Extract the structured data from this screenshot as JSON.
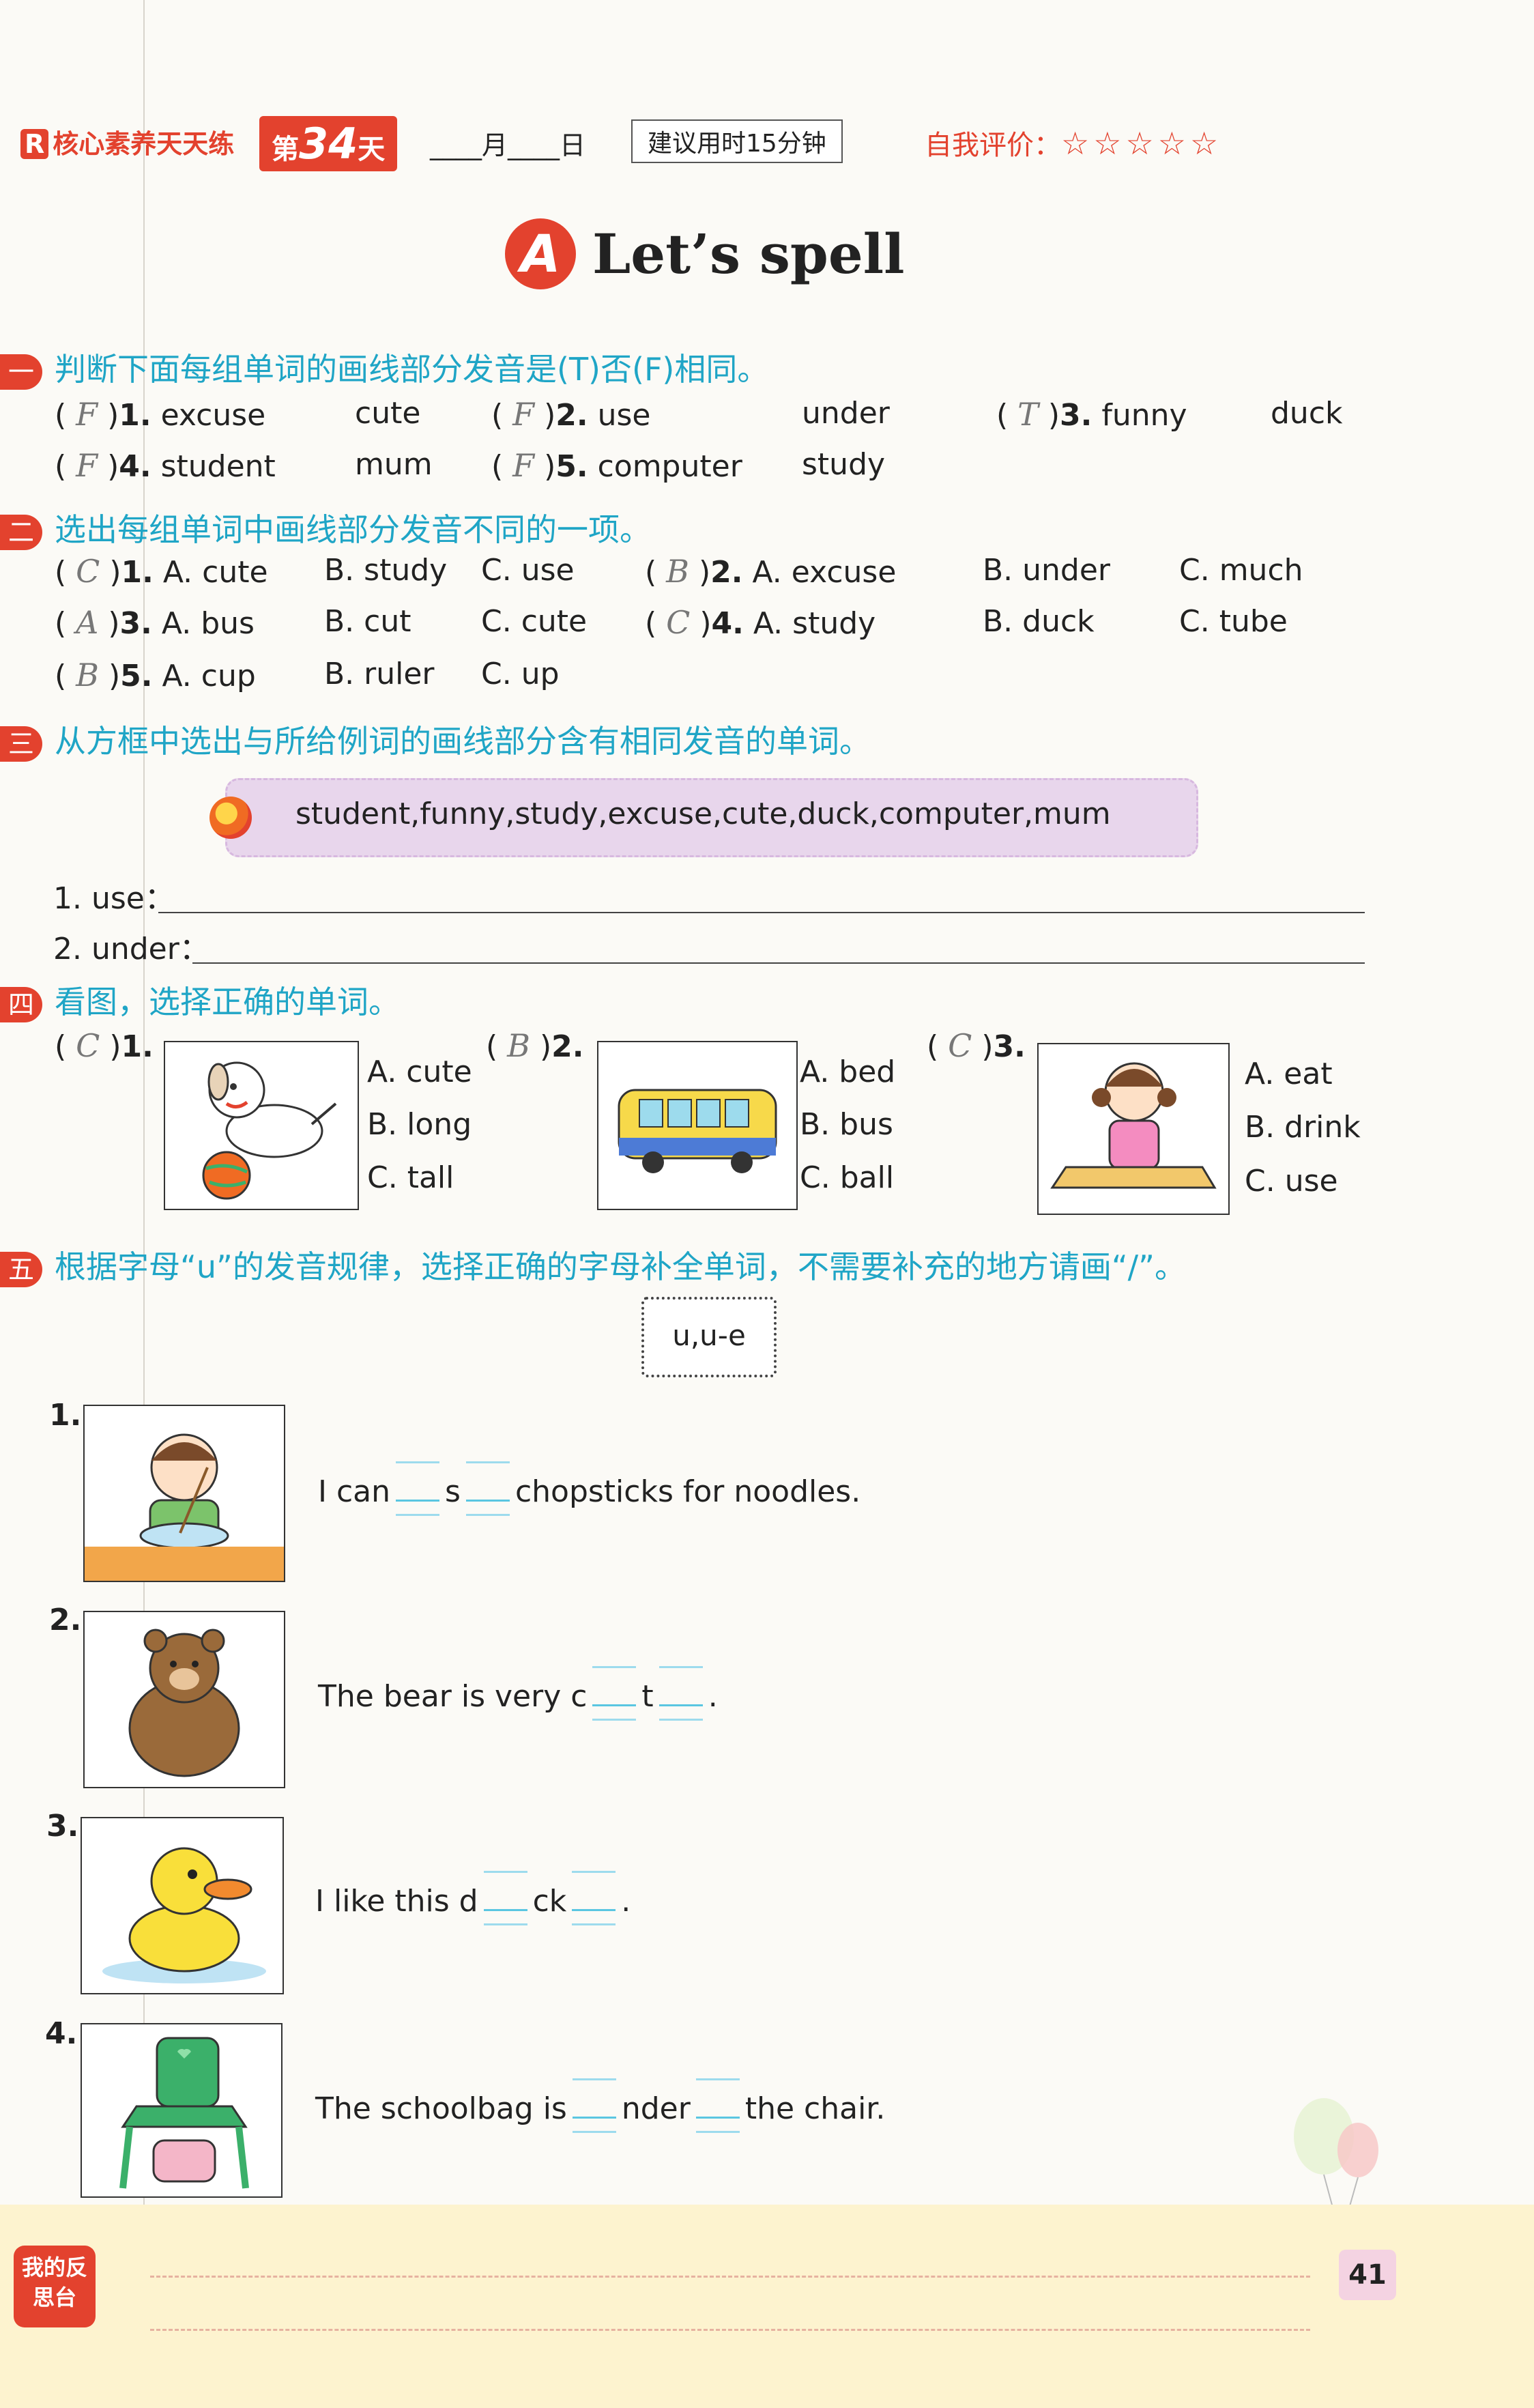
{
  "header": {
    "brand": "核心素养天天练",
    "brand_badge": "R",
    "day_prefix": "第",
    "day_num": "34",
    "day_suffix": "天",
    "date": "____月____日",
    "suggest": "建议用时15分钟",
    "rating_label": "自我评价：",
    "stars": "☆☆☆☆☆"
  },
  "section_a": {
    "badge": "A",
    "title": "Let’s spell"
  },
  "part1": {
    "num": "一",
    "title": "判断下面每组单词的画线部分发音是(T)否(F)相同。",
    "items": [
      {
        "num": "1.",
        "answer": "F",
        "w1": "excuse",
        "w2": "cute"
      },
      {
        "num": "2.",
        "answer": "F",
        "w1": "use",
        "w2": "under"
      },
      {
        "num": "3.",
        "answer": "T",
        "w1": "funny",
        "w2": "duck"
      },
      {
        "num": "4.",
        "answer": "F",
        "w1": "student",
        "w2": "mum"
      },
      {
        "num": "5.",
        "answer": "F",
        "w1": "computer",
        "w2": "study"
      }
    ]
  },
  "part2": {
    "num": "二",
    "title": "选出每组单词中画线部分发音不同的一项。",
    "items": [
      {
        "num": "1.",
        "answer": "C",
        "a": "A. cute",
        "b": "B. study",
        "c": "C. use"
      },
      {
        "num": "2.",
        "answer": "B",
        "a": "A. excuse",
        "b": "B. under",
        "c": "C. much"
      },
      {
        "num": "3.",
        "answer": "A",
        "a": "A. bus",
        "b": "B. cut",
        "c": "C. cute"
      },
      {
        "num": "4.",
        "answer": "C",
        "a": "A. study",
        "b": "B. duck",
        "c": "C. tube"
      },
      {
        "num": "5.",
        "answer": "B",
        "a": "A. cup",
        "b": "B. ruler",
        "c": "C. up"
      }
    ]
  },
  "part3": {
    "num": "三",
    "title": "从方框中选出与所给例词的画线部分含有相同发音的单词。",
    "words": "student,funny,study,excuse,cute,duck,computer,mum",
    "q1": "1. use：",
    "q2": "2. under："
  },
  "part4": {
    "num": "四",
    "title": "看图，选择正确的单词。",
    "items": [
      {
        "num": "1.",
        "answer": "C",
        "a": "A. cute",
        "b": "B. long",
        "c": "C. tall"
      },
      {
        "num": "2.",
        "answer": "B",
        "a": "A. bed",
        "b": "B. bus",
        "c": "C. ball"
      },
      {
        "num": "3.",
        "answer": "C",
        "a": "A. eat",
        "b": "B. drink",
        "c": "C. use"
      }
    ]
  },
  "part5": {
    "num": "五",
    "title": "根据字母“u”的发音规律，选择正确的字母补全单词，不需要补充的地方请画“/”。",
    "box": "u,u-e",
    "items": [
      {
        "num": "1.",
        "s1": "I can",
        "s2": "s",
        "s3": "chopsticks for noodles."
      },
      {
        "num": "2.",
        "s1": "The bear is very c",
        "s2": "t",
        "s3": "."
      },
      {
        "num": "3.",
        "s1": "I like this d",
        "s2": "ck",
        "s3": "."
      },
      {
        "num": "4.",
        "s1": "The schoolbag is",
        "s2": "nder",
        "s3": "the chair."
      }
    ]
  },
  "footer": {
    "reflect": "我的反思台",
    "page": "41"
  }
}
